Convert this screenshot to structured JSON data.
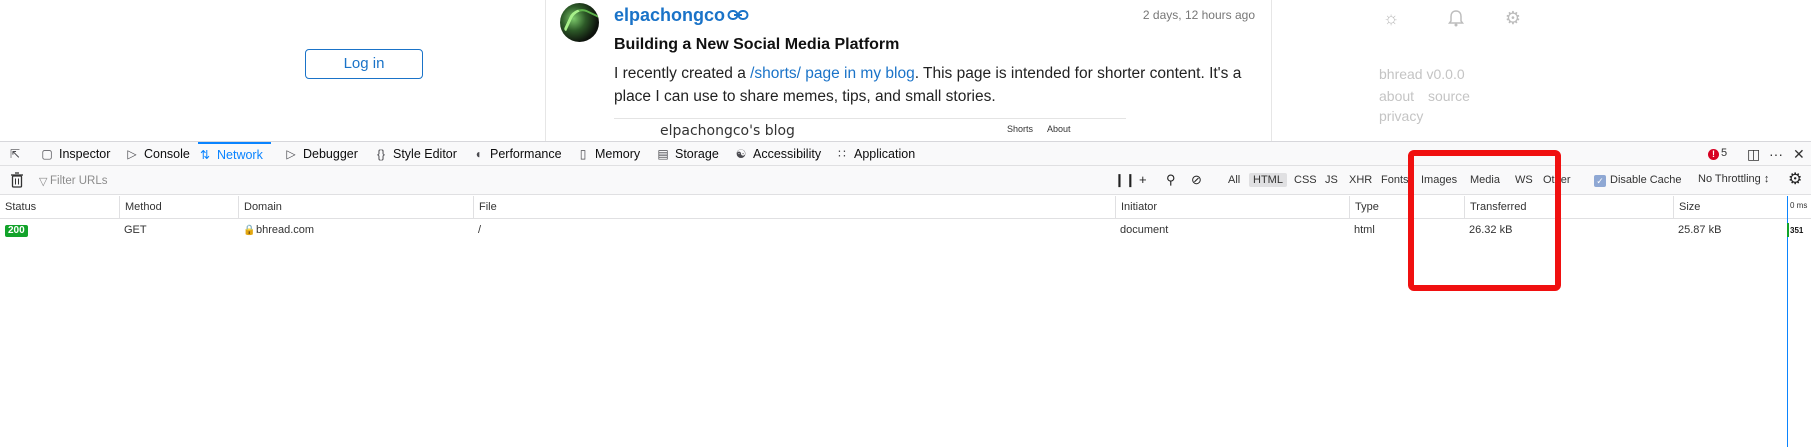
{
  "webpage": {
    "login_label": "Log in",
    "post": {
      "author": "elpachongco",
      "time": "2 days, 12 hours ago",
      "title": "Building a New Social Media Platform",
      "body_before": "I recently created a ",
      "body_link": "/shorts/ page in my blog",
      "body_after": ". This page is intended for shorter content. It's a place I can use to share memes, tips, and small stories.",
      "embed_title": "elpachongco's blog",
      "embed_nav": [
        "Shorts",
        "About"
      ]
    },
    "sidebar": {
      "version": "bhread v0.0.0",
      "links": [
        "about",
        "source"
      ],
      "privacy": "privacy"
    }
  },
  "devtools": {
    "tabs": [
      {
        "label": "Inspector",
        "icon": "inspector-icon"
      },
      {
        "label": "Console",
        "icon": "console-icon"
      },
      {
        "label": "Network",
        "icon": "network-icon",
        "active": true
      },
      {
        "label": "Debugger",
        "icon": "debugger-icon"
      },
      {
        "label": "Style Editor",
        "icon": "style-editor-icon"
      },
      {
        "label": "Performance",
        "icon": "performance-icon"
      },
      {
        "label": "Memory",
        "icon": "memory-icon"
      },
      {
        "label": "Storage",
        "icon": "storage-icon"
      },
      {
        "label": "Accessibility",
        "icon": "accessibility-icon"
      },
      {
        "label": "Application",
        "icon": "application-icon"
      }
    ],
    "error_count": "5",
    "filter_placeholder": "Filter URLs",
    "filter_types": [
      "All",
      "HTML",
      "CSS",
      "JS",
      "XHR",
      "Fonts",
      "Images",
      "Media",
      "WS",
      "Other"
    ],
    "active_filter": "HTML",
    "disable_cache_label": "Disable Cache",
    "disable_cache_checked": true,
    "throttle_label": "No Throttling ↕",
    "columns": [
      "Status",
      "Method",
      "Domain",
      "File",
      "Initiator",
      "Type",
      "Transferred",
      "Size"
    ],
    "waterfall_label": "0 ms",
    "requests": [
      {
        "status": "200",
        "method": "GET",
        "domain": "bhread.com",
        "file": "/",
        "initiator": "document",
        "type": "html",
        "transferred": "26.32 kB",
        "size": "25.87 kB",
        "timing": "351"
      }
    ]
  },
  "colors": {
    "accent": "#0a84ff",
    "link": "#1a73c8",
    "status_ok": "#12a32a",
    "highlight": "#f01010",
    "error": "#d70022"
  }
}
